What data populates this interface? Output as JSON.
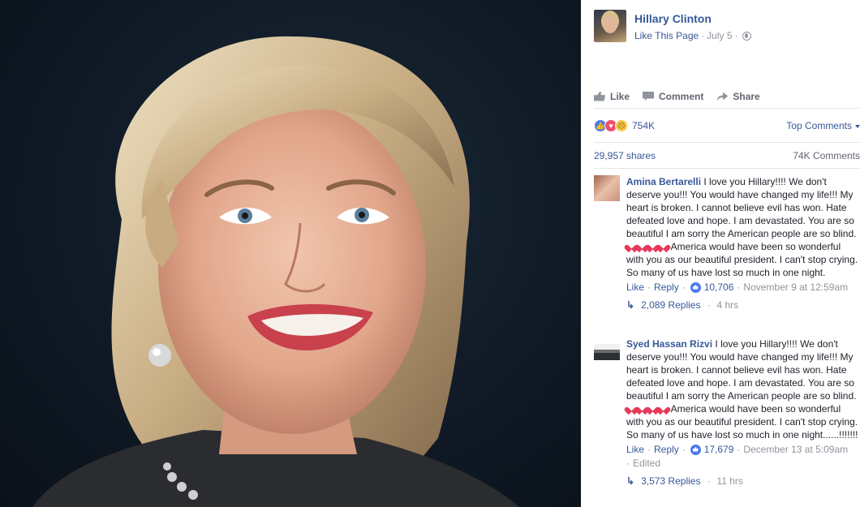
{
  "post": {
    "page_name": "Hillary Clinton",
    "like_page": "Like This Page",
    "date": "July 5",
    "sep": "·"
  },
  "actions": {
    "like": "Like",
    "comment": "Comment",
    "share": "Share"
  },
  "reactions": {
    "count": "754K",
    "sort": "Top Comments"
  },
  "stats": {
    "shares": "29,957 shares",
    "comments": "74K Comments"
  },
  "comments": [
    {
      "author": "Amina Bertarelli",
      "text_a": " I love you Hillary!!!! We don't deserve you!!! You would have changed my life!!! My heart is broken. I cannot believe evil has won. Hate defeated love and hope. I am devastated. You are so beautiful I am sorry the American people are so blind. ",
      "text_b": " America would have been so wonderful with you as our beautiful president. I can't stop crying. So many of us have lost so much in one night.",
      "like": "Like",
      "reply": "Reply",
      "likes": "10,706",
      "time": "November 9 at 12:59am",
      "replies": "2,089 Replies",
      "replies_time": "4 hrs"
    },
    {
      "author": "Syed Hassan Rizvi",
      "text_a": " I love you Hillary!!!! We don't deserve you!!! You would have changed my life!!! My heart is broken. I cannot believe evil has won. Hate defeated love and hope. I am devastated. You are so beautiful I am sorry the American people are so blind. ",
      "text_b": " America would have been so wonderful with you as our beautiful president. I can't stop crying. So many of us have lost so much in one night......!!!!!!!",
      "like": "Like",
      "reply": "Reply",
      "likes": "17,679",
      "time": "December 13 at 5:09am",
      "edited": "Edited",
      "replies": "3,573 Replies",
      "replies_time": "11 hrs"
    }
  ]
}
